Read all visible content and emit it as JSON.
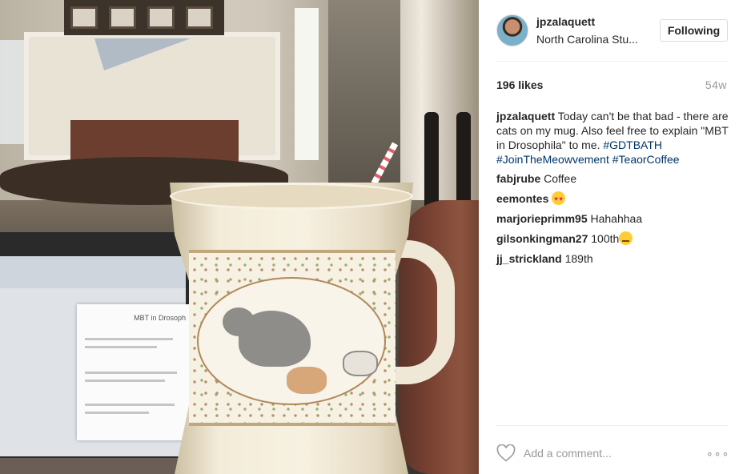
{
  "post": {
    "username": "jpzalaquett",
    "location": "North Carolina Stu...",
    "follow_label": "Following",
    "likes": "196 likes",
    "age": "54w",
    "caption": {
      "username": "jpzalaquett",
      "text": "Today can't be that bad - there are cats on my mug. Also feel free to explain \"MBT in Drosophila\" to me.",
      "tags": [
        "#GDTBATH",
        "#JoinTheMeowvement",
        "#TeaorCoffee"
      ]
    },
    "comments": [
      {
        "username": "fabjrube",
        "text": "Coffee"
      },
      {
        "username": "eemontes",
        "text": "",
        "emoji": "heart-eyes-emoji"
      },
      {
        "username": "marjorieprimm95",
        "text": "Hahahhaa"
      },
      {
        "username": "gilsonkingman27",
        "text": "100th",
        "emoji": "unamused-emoji"
      },
      {
        "username": "jj_strickland",
        "text": "189th"
      }
    ],
    "add_comment_placeholder": "Add a comment...",
    "more_label": "∘∘∘"
  },
  "photo": {
    "slide_title": "MBT in Drosoph"
  },
  "colors": {
    "hashtag": "#003569",
    "text": "#262626",
    "muted": "#999999",
    "divider": "#efefef"
  }
}
